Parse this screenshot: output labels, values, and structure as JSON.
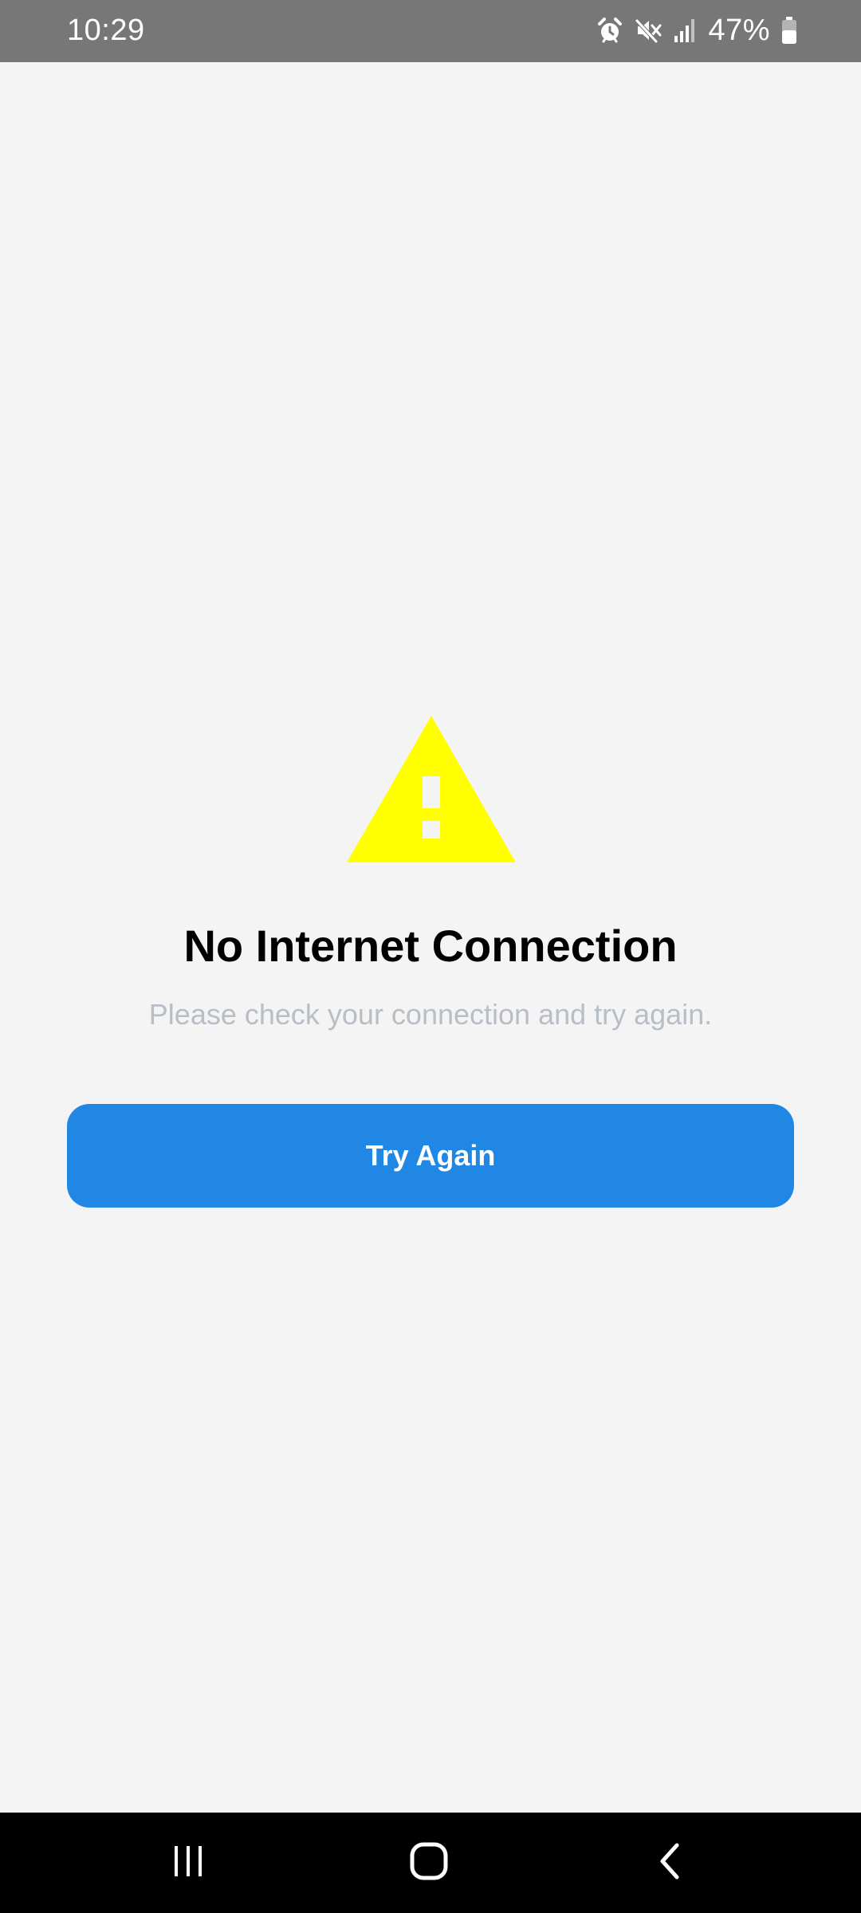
{
  "status_bar": {
    "time": "10:29",
    "battery_percent": "47%",
    "icons": [
      "alarm-icon",
      "mute-icon",
      "signal-icon",
      "battery-icon"
    ]
  },
  "error": {
    "icon": "warning-icon",
    "icon_color": "#ffff00",
    "title": "No Internet Connection",
    "message": "Please check your connection and try again.",
    "button_label": "Try Again",
    "button_color": "#2088e4"
  },
  "nav_bar": {
    "buttons": [
      "recents-icon",
      "home-icon",
      "back-icon"
    ]
  }
}
